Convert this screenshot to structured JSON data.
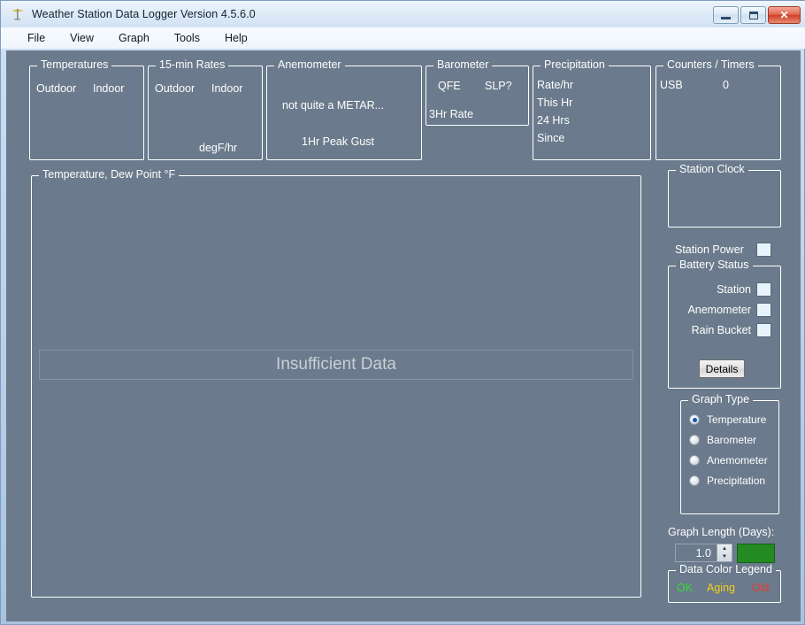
{
  "window": {
    "title": "Weather Station Data Logger Version 4.5.6.0",
    "icon": "weather-station-icon",
    "minimize": "–",
    "maximize": "□",
    "close": "✕"
  },
  "menu": {
    "items": [
      {
        "label": "File"
      },
      {
        "label": "View"
      },
      {
        "label": "Graph"
      },
      {
        "label": "Tools"
      },
      {
        "label": "Help"
      }
    ]
  },
  "panels": {
    "temperatures": {
      "title": "Temperatures",
      "outdoor_label": "Outdoor",
      "indoor_label": "Indoor",
      "outdoor_value": "",
      "indoor_value": ""
    },
    "rates": {
      "title": "15-min Rates",
      "outdoor_label": "Outdoor",
      "indoor_label": "Indoor",
      "units": "degF/hr",
      "outdoor_value": "",
      "indoor_value": ""
    },
    "anemometer": {
      "title": "Anemometer",
      "metar_label": "not quite a METAR...",
      "gust_label": "1Hr Peak Gust",
      "metar_value": "",
      "gust_value": ""
    },
    "barometer": {
      "title": "Barometer",
      "qfe_label": "QFE",
      "slp_label": "SLP?",
      "rate_label": "3Hr Rate",
      "qfe_value": "",
      "slp_value": "",
      "rate_value": ""
    },
    "precipitation": {
      "title": "Precipitation",
      "rows": [
        {
          "label": "Rate/hr",
          "value": ""
        },
        {
          "label": "This Hr",
          "value": ""
        },
        {
          "label": "24 Hrs",
          "value": ""
        },
        {
          "label": "Since",
          "value": ""
        }
      ]
    },
    "counters": {
      "title": "Counters / Timers",
      "usb_label": "USB",
      "usb_value": "0"
    },
    "graph": {
      "title": "Temperature, Dew Point °F",
      "empty_message": "Insufficient Data"
    },
    "station_clock": {
      "title": "Station Clock",
      "value": ""
    },
    "station_power": {
      "label": "Station Power",
      "indicator": "status-square"
    },
    "battery_status": {
      "title": "Battery Status",
      "rows": [
        {
          "label": "Station"
        },
        {
          "label": "Anemometer"
        },
        {
          "label": "Rain Bucket"
        }
      ],
      "details_button": "Details"
    },
    "graph_type": {
      "title": "Graph Type",
      "selected": "Temperature",
      "options": [
        {
          "label": "Temperature",
          "selected": true
        },
        {
          "label": "Barometer",
          "selected": false
        },
        {
          "label": "Anemometer",
          "selected": false
        },
        {
          "label": "Precipitation",
          "selected": false
        }
      ]
    },
    "graph_length": {
      "label": "Graph Length (Days):",
      "value": "1.0",
      "swatch_color": "#238b22",
      "up_arrow": "▲",
      "down_arrow": "▼"
    },
    "data_color_legend": {
      "title": "Data Color Legend",
      "items": [
        {
          "label": "OK",
          "color": "#2ee02e"
        },
        {
          "label": "Aging",
          "color": "#f2d11a"
        },
        {
          "label": "Old",
          "color": "#e83c2a"
        }
      ]
    }
  },
  "colors": {
    "client_background": "#6b7a8c",
    "group_border": "#ffffff",
    "text": "#ffffff",
    "accent_selected": "#1559b0"
  }
}
